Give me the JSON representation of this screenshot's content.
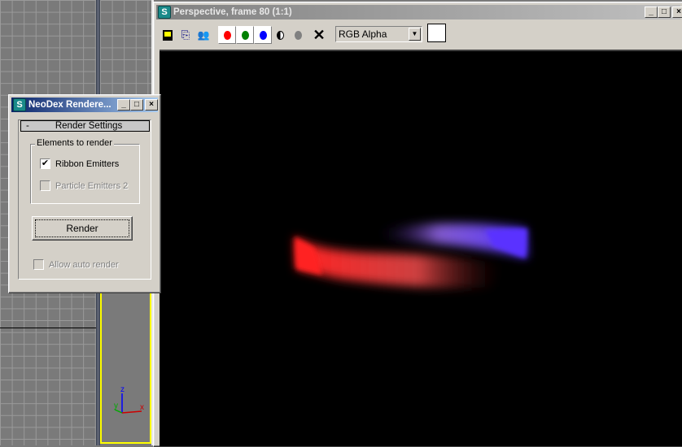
{
  "viewports": {
    "axis_labels": {
      "x": "x",
      "y": "y",
      "z": "z"
    }
  },
  "frame_window": {
    "title": "Perspective, frame 80 (1:1)",
    "toolbar": {
      "save_icon": "floppy-disk-icon",
      "copy_icon": "copy-icon",
      "clone_icon": "people-icon",
      "channels": [
        {
          "name": "red",
          "color": "#ff0000"
        },
        {
          "name": "green",
          "color": "#008000"
        },
        {
          "name": "blue",
          "color": "#0000ff"
        }
      ],
      "channel_select": "RGB Alpha",
      "swatch_color": "#ffffff"
    },
    "ribbon_colors": {
      "red": "#ff3030",
      "blue": "#6a3aff"
    }
  },
  "dialog": {
    "title": "NeoDex Rendere...",
    "rollout_toggle": "-",
    "rollout_title": "Render Settings",
    "group_title": "Elements to render",
    "ribbon_emitters": {
      "label": "Ribbon Emitters",
      "checked": true,
      "enabled": true
    },
    "particle_emitters": {
      "label": "Particle Emitters 2",
      "checked": false,
      "enabled": false
    },
    "render_button": "Render",
    "auto_render": {
      "label": "Allow auto render",
      "checked": false,
      "enabled": false
    }
  }
}
